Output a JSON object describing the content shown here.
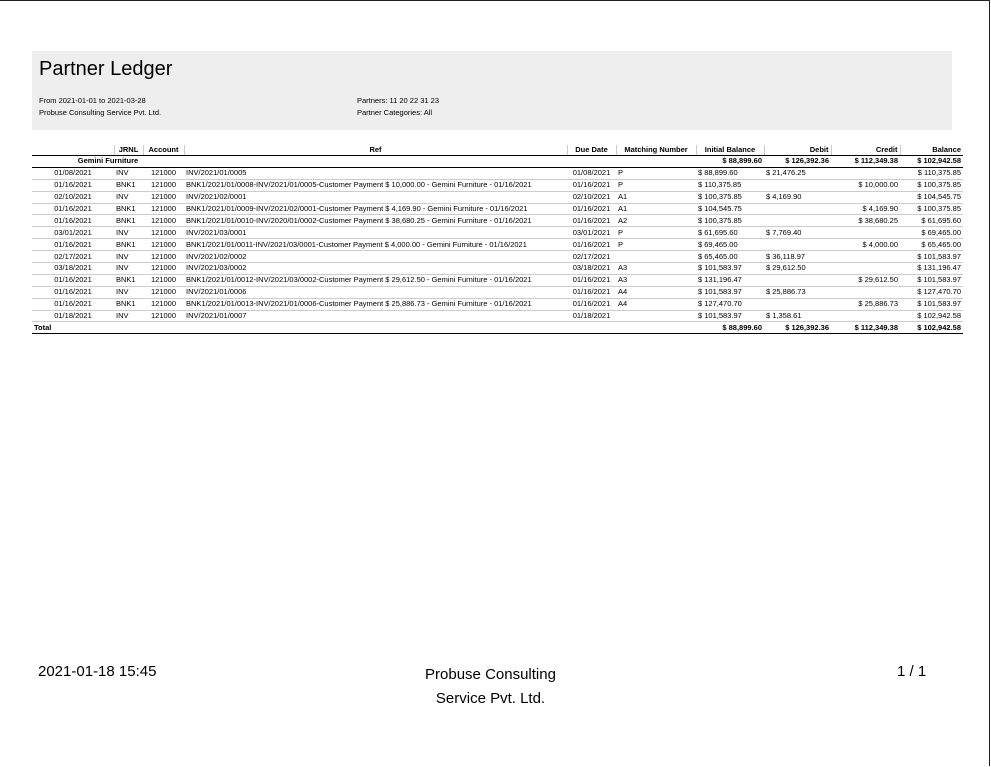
{
  "report": {
    "title": "Partner Ledger",
    "date_range": "From 2021-01-01 to 2021-03-28",
    "company": "Probuse Consulting Service Pvt. Ltd.",
    "partners": "Partners: 11 20 22 31 23",
    "partner_categories": "Partner Categories: All"
  },
  "table": {
    "headers": [
      "",
      "JRNL",
      "Account",
      "Ref",
      "Due Date",
      "Matching Number",
      "Initial Balance",
      "Debit",
      "Credit",
      "Balance"
    ],
    "partner": {
      "name": "Gemini Furniture",
      "initial_balance": "$ 88,899.60",
      "debit": "$ 126,392.36",
      "credit": "$ 112,349.38",
      "balance": "$ 102,942.58"
    },
    "rows": [
      [
        "01/08/2021",
        "INV",
        "121000",
        "INV/2021/01/0005",
        "01/08/2021",
        "P",
        "$ 88,899.60",
        "$ 21,476.25",
        "",
        "$ 110,375.85"
      ],
      [
        "01/16/2021",
        "BNK1",
        "121000",
        "BNK1/2021/01/0008-INV/2021/01/0005-Customer Payment $ 10,000.00 - Gemini Furniture - 01/16/2021",
        "01/16/2021",
        "P",
        "$ 110,375.85",
        "",
        "$ 10,000.00",
        "$ 100,375.85"
      ],
      [
        "02/10/2021",
        "INV",
        "121000",
        "INV/2021/02/0001",
        "02/10/2021",
        "A1",
        "$ 100,375.85",
        "$ 4,169.90",
        "",
        "$ 104,545.75"
      ],
      [
        "01/16/2021",
        "BNK1",
        "121000",
        "BNK1/2021/01/0009-INV/2021/02/0001-Customer Payment $ 4,169.90 - Gemini Furniture - 01/16/2021",
        "01/16/2021",
        "A1",
        "$ 104,545.75",
        "",
        "$ 4,169.90",
        "$ 100,375.85"
      ],
      [
        "01/16/2021",
        "BNK1",
        "121000",
        "BNK1/2021/01/0010-INV/2020/01/0002-Customer Payment $ 38,680.25 - Gemini Furniture - 01/16/2021",
        "01/16/2021",
        "A2",
        "$ 100,375.85",
        "",
        "$ 38,680.25",
        "$ 61,695.60"
      ],
      [
        "03/01/2021",
        "INV",
        "121000",
        "INV/2021/03/0001",
        "03/01/2021",
        "P",
        "$ 61,695.60",
        "$ 7,769.40",
        "",
        "$ 69,465.00"
      ],
      [
        "01/16/2021",
        "BNK1",
        "121000",
        "BNK1/2021/01/0011-INV/2021/03/0001-Customer Payment $ 4,000.00 - Gemini Furniture - 01/16/2021",
        "01/16/2021",
        "P",
        "$ 69,465.00",
        "",
        "$ 4,000.00",
        "$ 65,465.00"
      ],
      [
        "02/17/2021",
        "INV",
        "121000",
        "INV/2021/02/0002",
        "02/17/2021",
        "",
        "$ 65,465.00",
        "$ 36,118.97",
        "",
        "$ 101,583.97"
      ],
      [
        "03/18/2021",
        "INV",
        "121000",
        "INV/2021/03/0002",
        "03/18/2021",
        "A3",
        "$ 101,583.97",
        "$ 29,612.50",
        "",
        "$ 131,196.47"
      ],
      [
        "01/16/2021",
        "BNK1",
        "121000",
        "BNK1/2021/01/0012-INV/2021/03/0002-Customer Payment $ 29,612.50 - Gemini Furniture - 01/16/2021",
        "01/16/2021",
        "A3",
        "$ 131,196.47",
        "",
        "$ 29,612.50",
        "$ 101,583.97"
      ],
      [
        "01/16/2021",
        "INV",
        "121000",
        "INV/2021/01/0006",
        "01/16/2021",
        "A4",
        "$ 101,583.97",
        "$ 25,886.73",
        "",
        "$ 127,470.70"
      ],
      [
        "01/16/2021",
        "BNK1",
        "121000",
        "BNK1/2021/01/0013-INV/2021/01/0006-Customer Payment $ 25,886.73 - Gemini Furniture - 01/16/2021",
        "01/16/2021",
        "A4",
        "$ 127,470.70",
        "",
        "$ 25,886.73",
        "$ 101,583.97"
      ],
      [
        "01/18/2021",
        "INV",
        "121000",
        "INV/2021/01/0007",
        "01/18/2021",
        "",
        "$ 101,583.97",
        "$ 1,358.61",
        "",
        "$ 102,942.58"
      ]
    ],
    "total": {
      "label": "Total",
      "initial_balance": "$ 88,899.60",
      "debit": "$ 126,392.36",
      "credit": "$ 112,349.38",
      "balance": "$ 102,942.58"
    }
  },
  "footer": {
    "datetime": "2021-01-18 15:45",
    "company": "Probuse Consulting Service Pvt. Ltd.",
    "page": "1 / 1"
  }
}
